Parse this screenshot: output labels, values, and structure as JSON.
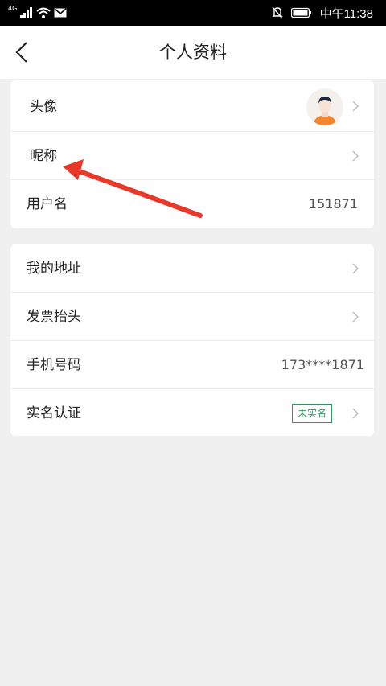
{
  "status_bar": {
    "network": "4G",
    "time": "中午11:38",
    "icons": [
      "signal-icon",
      "wifi-icon",
      "mail-icon",
      "mute-icon",
      "battery-icon"
    ]
  },
  "header": {
    "title": "个人资料",
    "back_icon": "chevron-left-icon"
  },
  "profile_section": {
    "avatar_label": "头像",
    "nickname_label": "昵称",
    "username_label": "用户名",
    "username_value": "151871"
  },
  "info_section": {
    "address_label": "我的地址",
    "invoice_label": "发票抬头",
    "phone_label": "手机号码",
    "phone_value": "173****1871",
    "realname_label": "实名认证",
    "realname_status": "未实名"
  },
  "colors": {
    "background": "#f0f0f0",
    "card": "#ffffff",
    "badge_green": "#2a9a5a",
    "annotation_arrow": "#e8382a"
  }
}
